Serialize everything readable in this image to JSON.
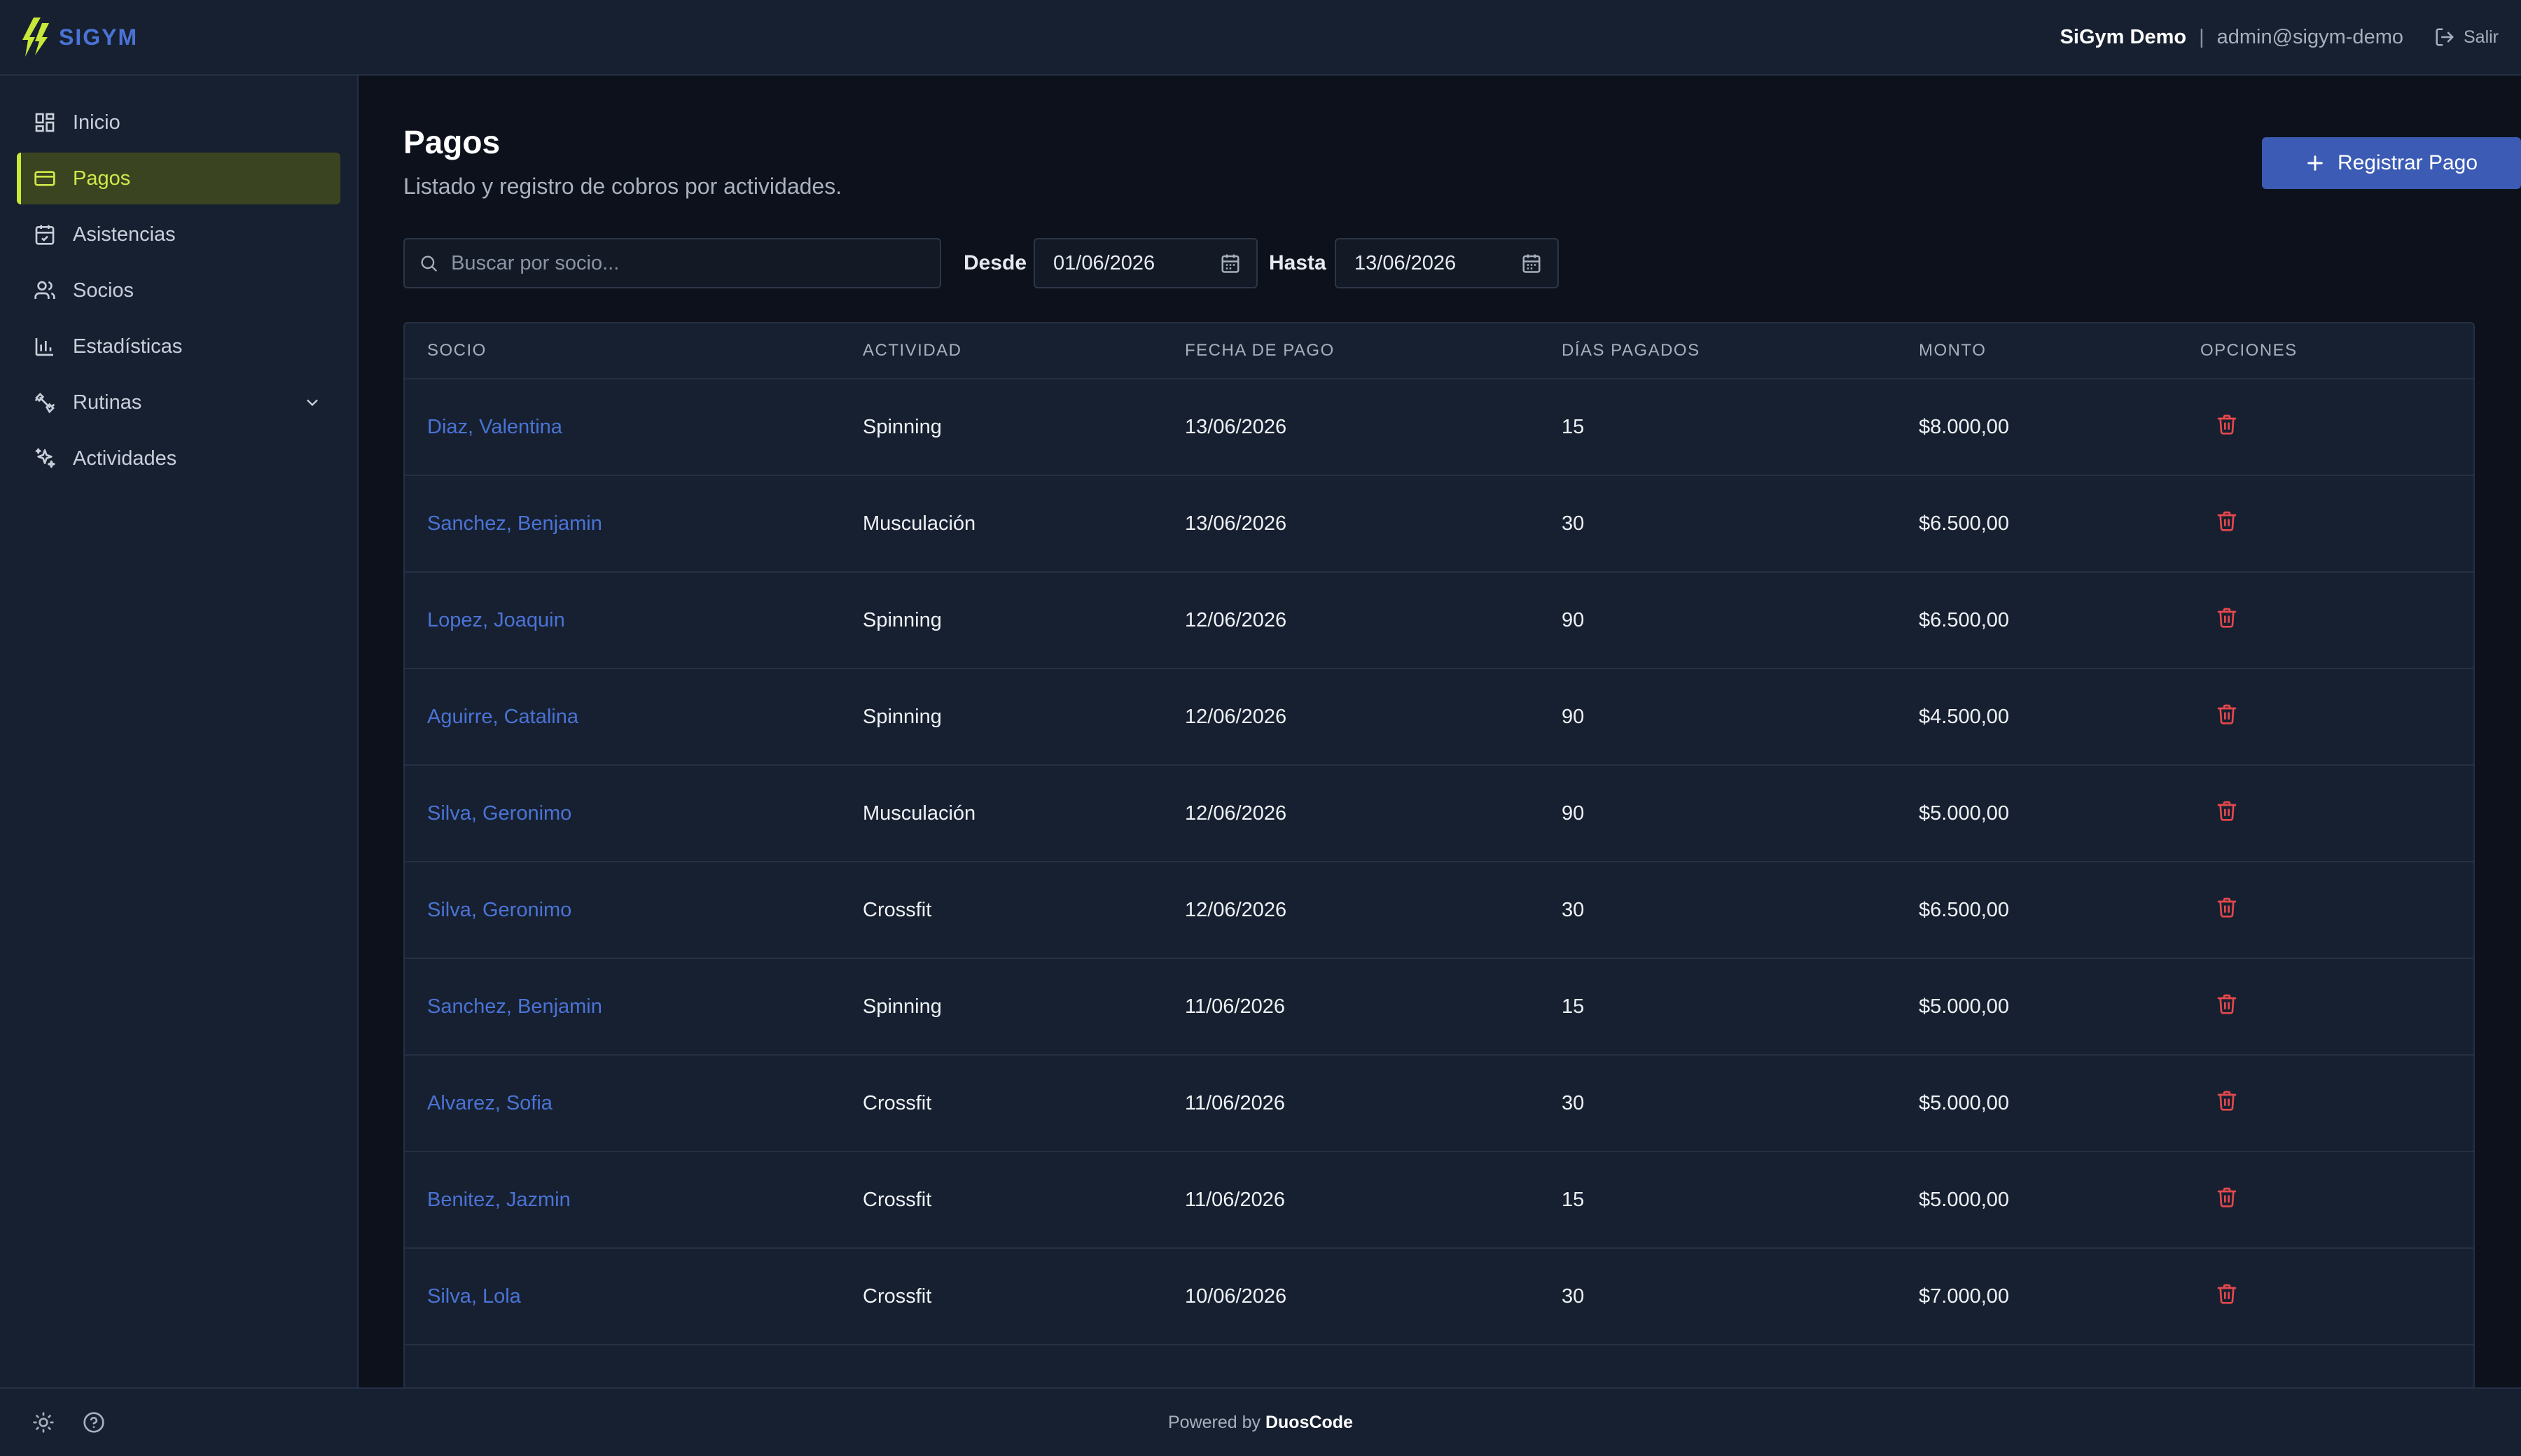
{
  "header": {
    "brand": "SIGYM",
    "org_name": "SiGym Demo",
    "separator": "|",
    "user_email": "admin@sigym-demo",
    "logout_label": "Salir"
  },
  "sidebar": {
    "items": [
      {
        "label": "Inicio",
        "icon": "dashboard-icon"
      },
      {
        "label": "Pagos",
        "icon": "credit-card-icon",
        "active": true
      },
      {
        "label": "Asistencias",
        "icon": "calendar-check-icon"
      },
      {
        "label": "Socios",
        "icon": "users-icon"
      },
      {
        "label": "Estadísticas",
        "icon": "bar-chart-icon"
      },
      {
        "label": "Rutinas",
        "icon": "dumbbell-icon",
        "expandable": true
      },
      {
        "label": "Actividades",
        "icon": "sparkles-icon"
      }
    ]
  },
  "page": {
    "title": "Pagos",
    "subtitle": "Listado y registro de cobros por actividades.",
    "primary_button": "Registrar Pago"
  },
  "filters": {
    "search_placeholder": "Buscar por socio...",
    "from_label": "Desde",
    "from_value": "01/06/2026",
    "to_label": "Hasta",
    "to_value": "13/06/2026"
  },
  "table": {
    "columns": [
      "Socio",
      "Actividad",
      "Fecha de pago",
      "Días pagados",
      "Monto",
      "Opciones"
    ],
    "rows": [
      {
        "socio": "Diaz, Valentina",
        "actividad": "Spinning",
        "fecha": "13/06/2026",
        "dias": "15",
        "monto": "$8.000,00"
      },
      {
        "socio": "Sanchez, Benjamin",
        "actividad": "Musculación",
        "fecha": "13/06/2026",
        "dias": "30",
        "monto": "$6.500,00"
      },
      {
        "socio": "Lopez, Joaquin",
        "actividad": "Spinning",
        "fecha": "12/06/2026",
        "dias": "90",
        "monto": "$6.500,00"
      },
      {
        "socio": "Aguirre, Catalina",
        "actividad": "Spinning",
        "fecha": "12/06/2026",
        "dias": "90",
        "monto": "$4.500,00"
      },
      {
        "socio": "Silva, Geronimo",
        "actividad": "Musculación",
        "fecha": "12/06/2026",
        "dias": "90",
        "monto": "$5.000,00"
      },
      {
        "socio": "Silva, Geronimo",
        "actividad": "Crossfit",
        "fecha": "12/06/2026",
        "dias": "30",
        "monto": "$6.500,00"
      },
      {
        "socio": "Sanchez, Benjamin",
        "actividad": "Spinning",
        "fecha": "11/06/2026",
        "dias": "15",
        "monto": "$5.000,00"
      },
      {
        "socio": "Alvarez, Sofia",
        "actividad": "Crossfit",
        "fecha": "11/06/2026",
        "dias": "30",
        "monto": "$5.000,00"
      },
      {
        "socio": "Benitez, Jazmin",
        "actividad": "Crossfit",
        "fecha": "11/06/2026",
        "dias": "15",
        "monto": "$5.000,00"
      },
      {
        "socio": "Silva, Lola",
        "actividad": "Crossfit",
        "fecha": "10/06/2026",
        "dias": "30",
        "monto": "$7.000,00"
      }
    ]
  },
  "footer": {
    "powered_prefix": "Powered by",
    "powered_brand": "DuosCode"
  },
  "colors": {
    "accent": "#3b5bb4",
    "link": "#4a73d6",
    "active_nav": "#c8e83a",
    "delete": "#e5484d",
    "background": "#0c111b",
    "panel": "#172030"
  }
}
